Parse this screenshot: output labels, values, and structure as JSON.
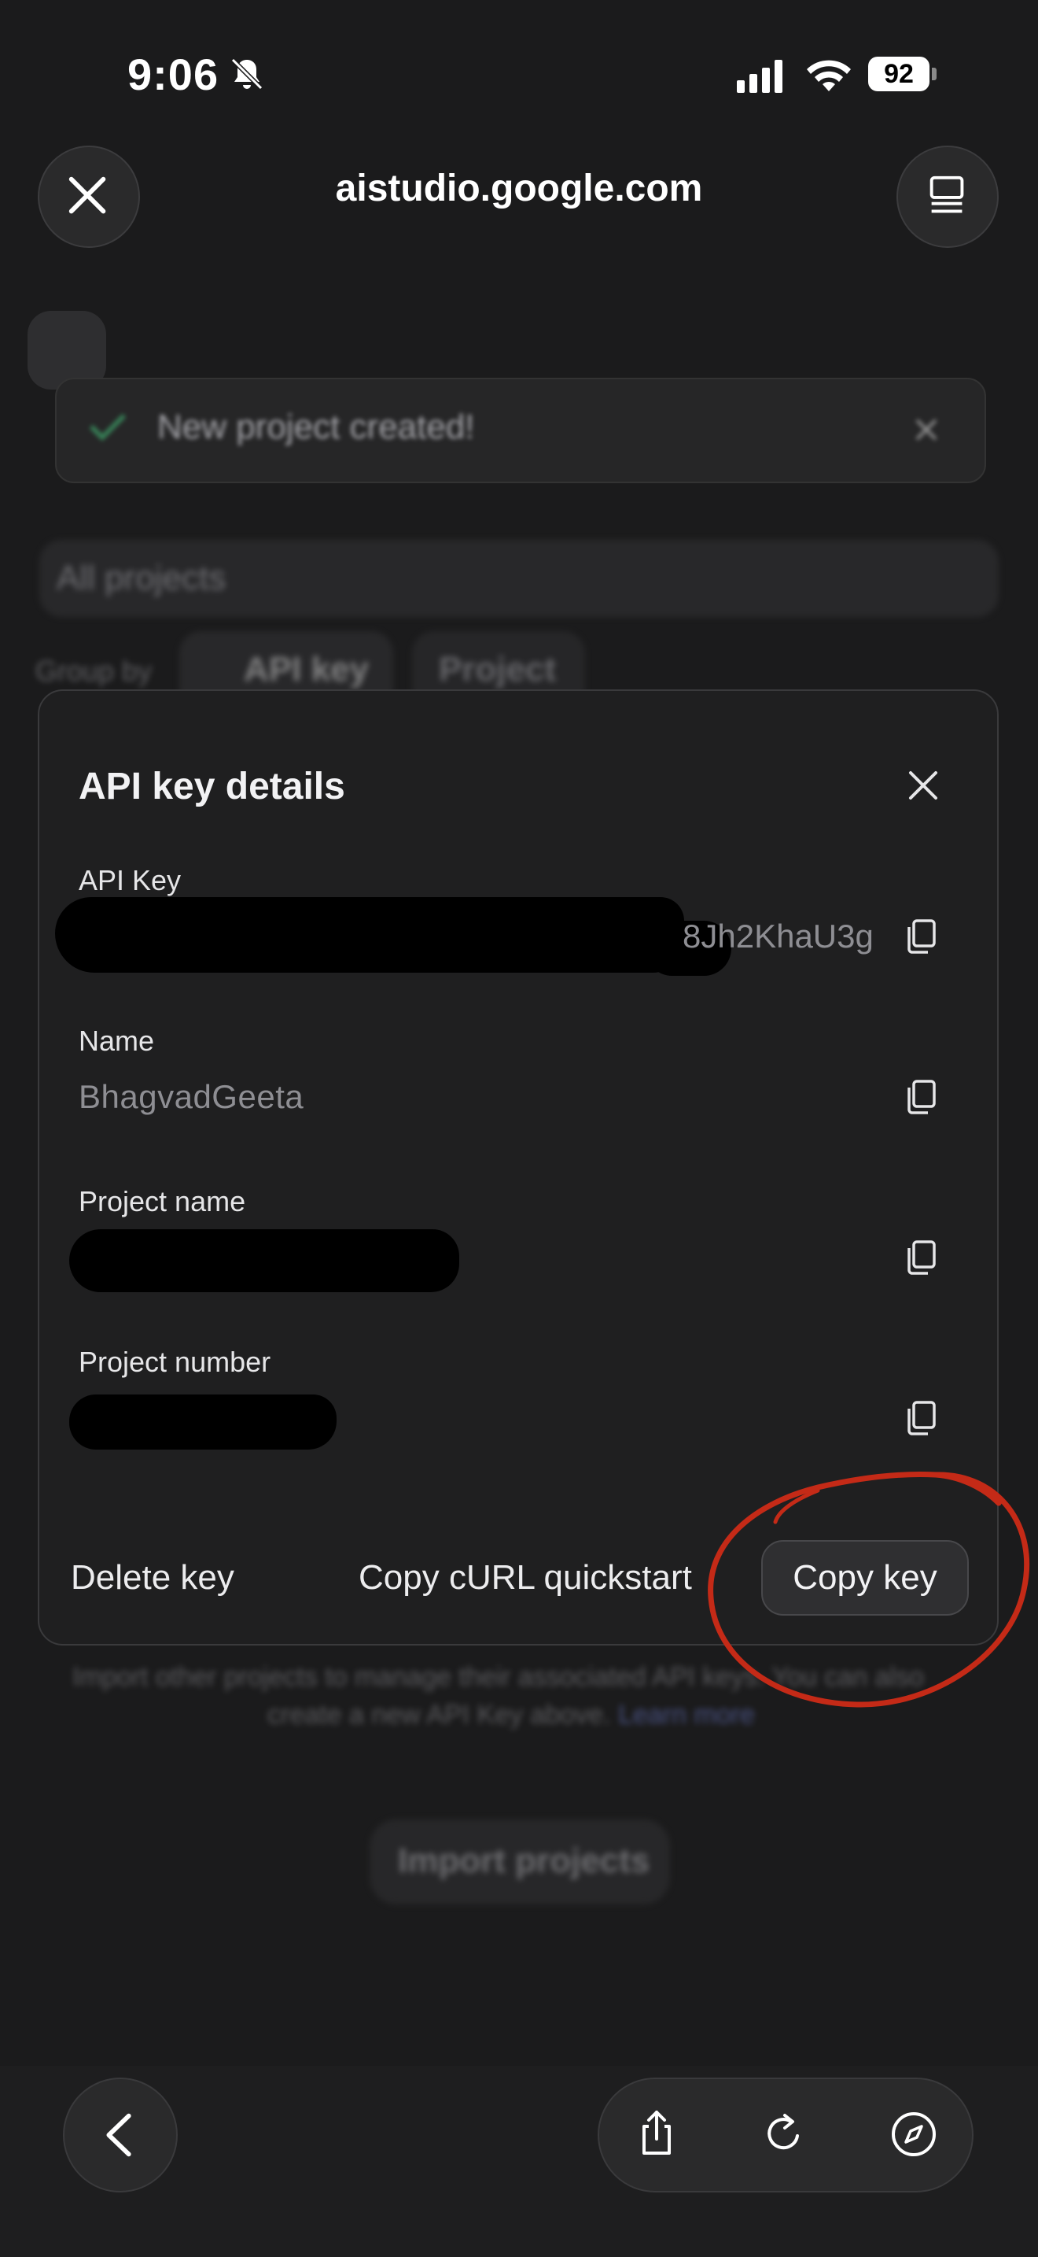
{
  "status_bar": {
    "time": "9:06",
    "battery": "92"
  },
  "browser": {
    "url": "aistudio.google.com"
  },
  "background_page": {
    "toast": "New project created!",
    "project_filter": "All projects",
    "group_by_label": "Group by",
    "group_by_options": [
      "API key",
      "Project"
    ],
    "info_text_line1": "Import other projects to manage their associated API keys. You can also",
    "info_text_line2": "create a new API Key above.",
    "learn_more": "Learn more",
    "import_button": "Import projects"
  },
  "modal": {
    "title": "API key details",
    "fields": [
      {
        "label": "API Key",
        "value": "8Jh2KhaU3g"
      },
      {
        "label": "Name",
        "value": "BhagvadGeeta"
      },
      {
        "label": "Project name",
        "value": ""
      },
      {
        "label": "Project number",
        "value": ""
      }
    ],
    "buttons": {
      "delete": "Delete key",
      "copy_curl": "Copy cURL quickstart",
      "copy_key": "Copy key"
    }
  },
  "colors": {
    "background": "#1b1b1c",
    "modal": "#1f1f20",
    "annotation": "#c42a17",
    "link": "#6f7fd6"
  },
  "icons": [
    "bell-slash-icon",
    "signal-icon",
    "wifi-icon",
    "close-icon",
    "tabs-icon",
    "copy-icon",
    "chevron-left-icon",
    "share-icon",
    "reload-icon",
    "compass-icon"
  ]
}
